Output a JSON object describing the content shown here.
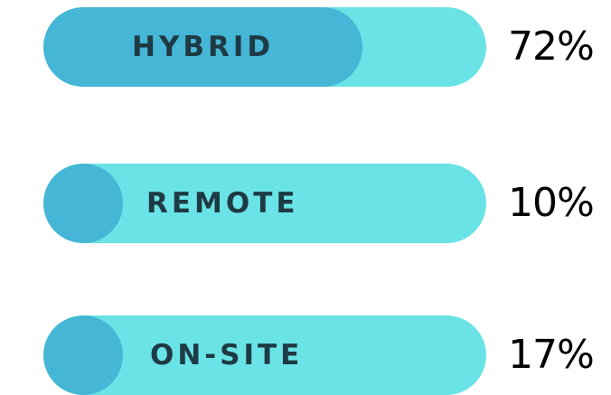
{
  "chart_data": {
    "type": "bar",
    "orientation": "horizontal",
    "categories": [
      "HYBRID",
      "REMOTE",
      "ON-SITE"
    ],
    "values": [
      72,
      10,
      17
    ],
    "value_labels": [
      "72%",
      "10%",
      "17%"
    ],
    "unit": "%",
    "xlim": [
      0,
      100
    ],
    "grid": false,
    "legend": "none"
  },
  "colors": {
    "track": "#6ae3e6",
    "fill": "#45b6d6",
    "label": "#1e3a44",
    "value": "#000000"
  }
}
